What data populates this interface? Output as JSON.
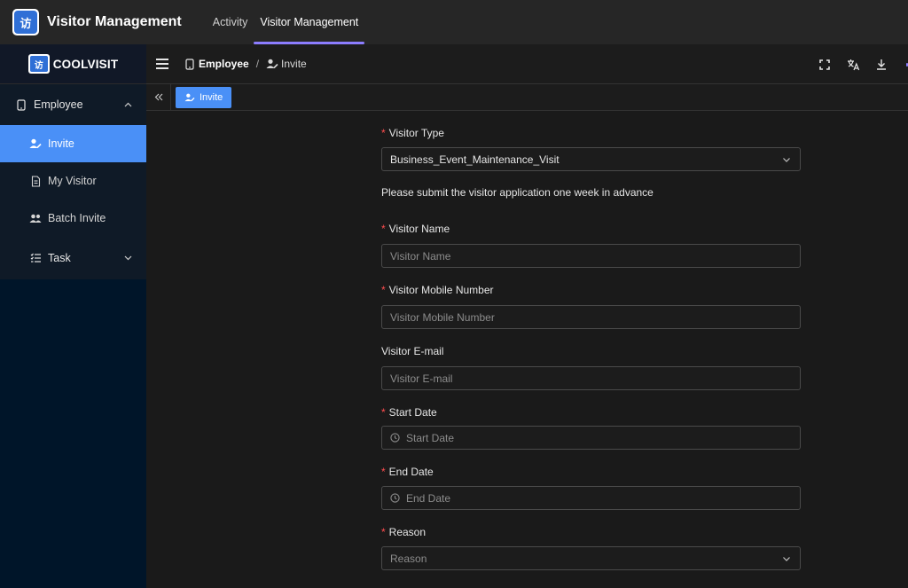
{
  "app": {
    "logo_text": "访",
    "title": "Visitor Management",
    "nav": [
      {
        "label": "Activity",
        "active": false
      },
      {
        "label": "Visitor Management",
        "active": true
      }
    ],
    "accent": "#8c7dff"
  },
  "brand": {
    "badge_text": "访",
    "name": "COOLVISIT"
  },
  "header": {
    "breadcrumb_parent": "Employee",
    "breadcrumb_sep": "/",
    "breadcrumb_current": "Invite",
    "tools": [
      "fullscreen-icon",
      "translate-icon",
      "download-icon"
    ]
  },
  "sidebar": {
    "group": {
      "label": "Employee",
      "icon": "device-icon",
      "expanded": true
    },
    "items": [
      {
        "label": "Invite",
        "icon": "user-edit-icon",
        "active": true
      },
      {
        "label": "My Visitor",
        "icon": "document-icon",
        "active": false
      },
      {
        "label": "Batch Invite",
        "icon": "users-icon",
        "active": false
      }
    ],
    "task": {
      "label": "Task",
      "icon": "task-list-icon",
      "expanded": false
    },
    "active_color": "#4a90f7"
  },
  "tabs": [
    {
      "label": "Invite",
      "icon": "user-edit-icon"
    }
  ],
  "form": {
    "visitor_type": {
      "label": "Visitor Type",
      "required": true,
      "value": "Business_Event_Maintenance_Visit"
    },
    "notice": "Please submit the visitor application one week in advance",
    "visitor_name": {
      "label": "Visitor Name",
      "required": true,
      "placeholder": "Visitor Name"
    },
    "visitor_mobile": {
      "label": "Visitor Mobile Number",
      "required": true,
      "placeholder": "Visitor Mobile Number"
    },
    "visitor_email": {
      "label": "Visitor E-mail",
      "required": false,
      "placeholder": "Visitor E-mail"
    },
    "start_date": {
      "label": "Start Date",
      "required": true,
      "placeholder": "Start Date"
    },
    "end_date": {
      "label": "End Date",
      "required": true,
      "placeholder": "End Date"
    },
    "reason": {
      "label": "Reason",
      "required": true,
      "placeholder": "Reason"
    },
    "required_mark": "*",
    "required_color": "#ff4d4f"
  }
}
